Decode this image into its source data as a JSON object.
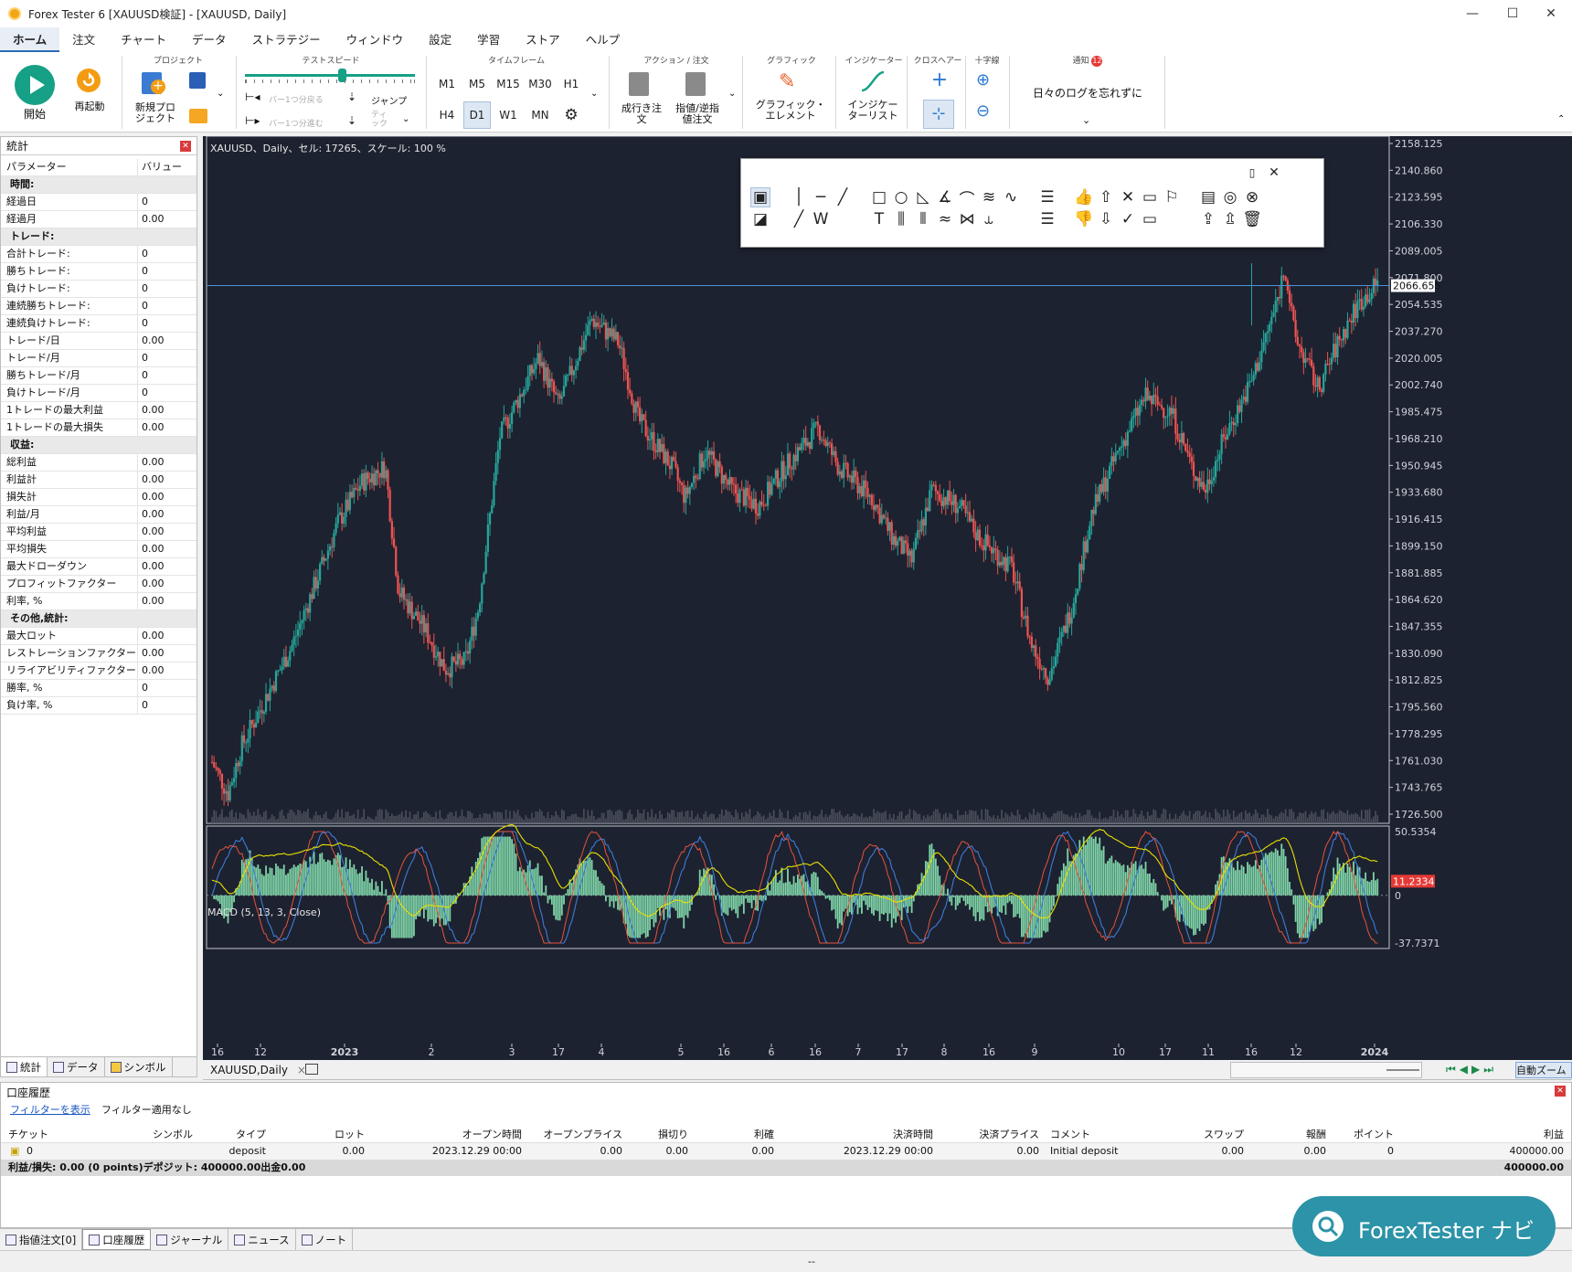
{
  "window": {
    "title": "Forex Tester 6  [XAUUSD検証] - [XAUUSD, Daily]",
    "min": "—",
    "max": "☐",
    "close": "✕"
  },
  "menu": [
    "ホーム",
    "注文",
    "チャート",
    "データ",
    "ストラテジー",
    "ウィンドウ",
    "設定",
    "学習",
    "ストア",
    "ヘルプ"
  ],
  "ribbon": {
    "start": "開始",
    "restart": "再起動",
    "project_group": "プロジェクト",
    "new_project": "新規プロ\nジェクト",
    "speed_group": "テストスピード",
    "bar_back": "バー1つ分戻る",
    "bar_fwd": "バー1つ分進む",
    "jump": "ジャンプ",
    "tick": "ティ\nック",
    "tf_group": "タイムフレーム",
    "timeframes": [
      "M1",
      "M5",
      "M15",
      "M30",
      "H1",
      "H4",
      "D1",
      "W1",
      "MN"
    ],
    "selected_tf": "D1",
    "action_group": "アクション / 注文",
    "market_order": "成行き注\n文",
    "limit_order": "指値/逆指\n値注文",
    "graphic_group": "グラフィック",
    "graphic_elem": "グラフィック・\nエレメント",
    "indicator_group": "インジケーター",
    "indicator_list": "インジケー\nターリスト",
    "crosshair_group": "クロスヘアー",
    "cross_group": "十字線",
    "notify_group": "通知",
    "notify_count": "12",
    "notify_text": "日々のログを忘れずに"
  },
  "stats": {
    "title": "統計",
    "col_param": "パラメーター",
    "col_value": "バリュー",
    "rows": [
      {
        "k": "時間:",
        "sec": true
      },
      {
        "k": "経過日",
        "v": "0"
      },
      {
        "k": "経過月",
        "v": "0.00"
      },
      {
        "k": "トレード:",
        "sec": true
      },
      {
        "k": "合計トレード:",
        "v": "0"
      },
      {
        "k": "勝ちトレード:",
        "v": "0"
      },
      {
        "k": "負けトレード:",
        "v": "0"
      },
      {
        "k": "連続勝ちトレード:",
        "v": "0"
      },
      {
        "k": "連続負けトレード:",
        "v": "0"
      },
      {
        "k": "トレード/日",
        "v": "0.00"
      },
      {
        "k": "トレード/月",
        "v": "0"
      },
      {
        "k": "勝ちトレード/月",
        "v": "0"
      },
      {
        "k": "負けトレード/月",
        "v": "0"
      },
      {
        "k": "1トレードの最大利益",
        "v": "0.00"
      },
      {
        "k": "1トレードの最大損失",
        "v": "0.00"
      },
      {
        "k": "収益:",
        "sec": true
      },
      {
        "k": "総利益",
        "v": "0.00"
      },
      {
        "k": "利益計",
        "v": "0.00"
      },
      {
        "k": "損失計",
        "v": "0.00"
      },
      {
        "k": "利益/月",
        "v": "0.00"
      },
      {
        "k": "平均利益",
        "v": "0.00"
      },
      {
        "k": "平均損失",
        "v": "0.00"
      },
      {
        "k": "最大ドローダウン",
        "v": "0.00"
      },
      {
        "k": "プロフィットファクター",
        "v": "0.00"
      },
      {
        "k": "利率, %",
        "v": "0.00"
      },
      {
        "k": "その他,統計:",
        "sec": true
      },
      {
        "k": "最大ロット",
        "v": "0.00"
      },
      {
        "k": "レストレーションファクター",
        "v": "0.00"
      },
      {
        "k": "リライアビリティファクター",
        "v": "0.00"
      },
      {
        "k": "勝率, %",
        "v": "0"
      },
      {
        "k": "負け率, %",
        "v": "0"
      }
    ],
    "tabs": [
      "統計",
      "データ",
      "シンボル"
    ]
  },
  "chart": {
    "info": "XAUUSD、Daily、セル: 17265、スケール: 100 %",
    "price_ticks": [
      "2158.125",
      "2140.860",
      "2123.595",
      "2106.330",
      "2089.005",
      "2071.800",
      "2054.535",
      "2037.270",
      "2020.005",
      "2002.740",
      "1985.475",
      "1968.210",
      "1950.945",
      "1933.680",
      "1916.415",
      "1899.150",
      "1881.885",
      "1864.620",
      "1847.355",
      "1830.090",
      "1812.825",
      "1795.560",
      "1778.295",
      "1761.030",
      "1743.765",
      "1726.500"
    ],
    "current_price": "2066.655",
    "macd_label": "MACD (5, 13, 3, Close)",
    "macd_ticks": [
      "50.5354",
      "0",
      "-37.7371"
    ],
    "macd_value": "11.2334",
    "date_labels": [
      "16",
      "12",
      "2023",
      "2",
      "3",
      "17",
      "4",
      "5",
      "16",
      "6",
      "16",
      "7",
      "17",
      "8",
      "16",
      "9",
      "10",
      "17",
      "11",
      "16",
      "12",
      "2024"
    ],
    "tab": "XAUUSD,Daily",
    "tab_close": "×",
    "autoscroll": "自動ズーム"
  },
  "history": {
    "title": "口座履歴",
    "filter_link": "フィルターを表示",
    "filter_state": "フィルター適用なし",
    "columns": [
      "チケット",
      "シンボル",
      "タイプ",
      "ロット",
      "オープン時間",
      "オープンプライス",
      "損切り",
      "利確",
      "決済時間",
      "決済プライス",
      "コメント",
      "スワップ",
      "報酬",
      "ポイント",
      "利益"
    ],
    "row": [
      "0",
      "",
      "deposit",
      "0.00",
      "2023.12.29 00:00",
      "0.00",
      "0.00",
      "0.00",
      "2023.12.29 00:00",
      "0.00",
      "Initial deposit",
      "0.00",
      "0.00",
      "0",
      "400000.00"
    ],
    "summary": "利益/損失: 0.00 (0 points)デポジット: 400000.00出金0.00",
    "summary_total": "400000.00"
  },
  "bottom_tabs": [
    "指値注文[0]",
    "口座履歴",
    "ジャーナル",
    "ニュース",
    "ノート"
  ],
  "status": "--",
  "navi": "ForexTester ナビ",
  "colors": {
    "bg": "#1d2230",
    "up": "#26a69a",
    "down": "#ef5350",
    "macd_signal": "#e8e000"
  }
}
